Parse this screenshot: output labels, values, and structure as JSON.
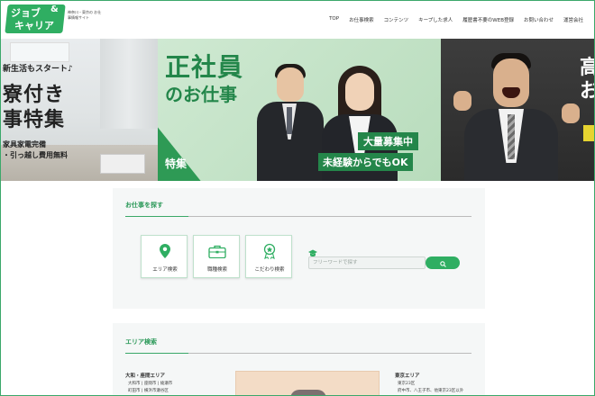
{
  "header": {
    "logo": {
      "line1": "ジョブ",
      "amp": "&",
      "line2": "キャリア",
      "sub": "神奈川・東京の お仕事情報サイト"
    },
    "nav": [
      "TOP",
      "お仕事検索",
      "コンテンツ",
      "キープした求人",
      "履歴書不要のWEB登録",
      "お問い合わせ",
      "運営会社"
    ]
  },
  "hero": {
    "left": {
      "line1": "新生活もスタート♪",
      "line2": "寮付き",
      "line3": "事特集",
      "line4": "家具家電完備",
      "line5": "・引っ越し費用無料"
    },
    "main": {
      "title1": "正社員",
      "title2": "のお仕事",
      "feature": "特集",
      "badge1": "大量募集中",
      "badge2": "未経験からでもOK"
    },
    "right": {
      "text": "高\nお"
    }
  },
  "search": {
    "title": "お仕事を探す",
    "buttons": [
      {
        "label": "エリア検索",
        "icon": "map-pin-icon"
      },
      {
        "label": "職種検索",
        "icon": "briefcase-icon"
      },
      {
        "label": "こだわり検索",
        "icon": "award-icon"
      }
    ],
    "keyword_placeholder": "フリーワードで探す",
    "search_button_icon": "search-icon"
  },
  "area": {
    "title": "エリア検索",
    "left": {
      "heading": "大和・座間エリア",
      "lines": [
        "大和市 | 座間市 | 綾瀬市",
        "町田市 | 横浜市瀬谷区"
      ]
    },
    "right": {
      "heading": "東京エリア",
      "lines": [
        "東京23区",
        "府中市、八王子市、他東京23区以外"
      ]
    }
  },
  "colors": {
    "accent": "#2fae62",
    "heading": "#2d9a5a",
    "section_bg": "#f5f7f7"
  }
}
